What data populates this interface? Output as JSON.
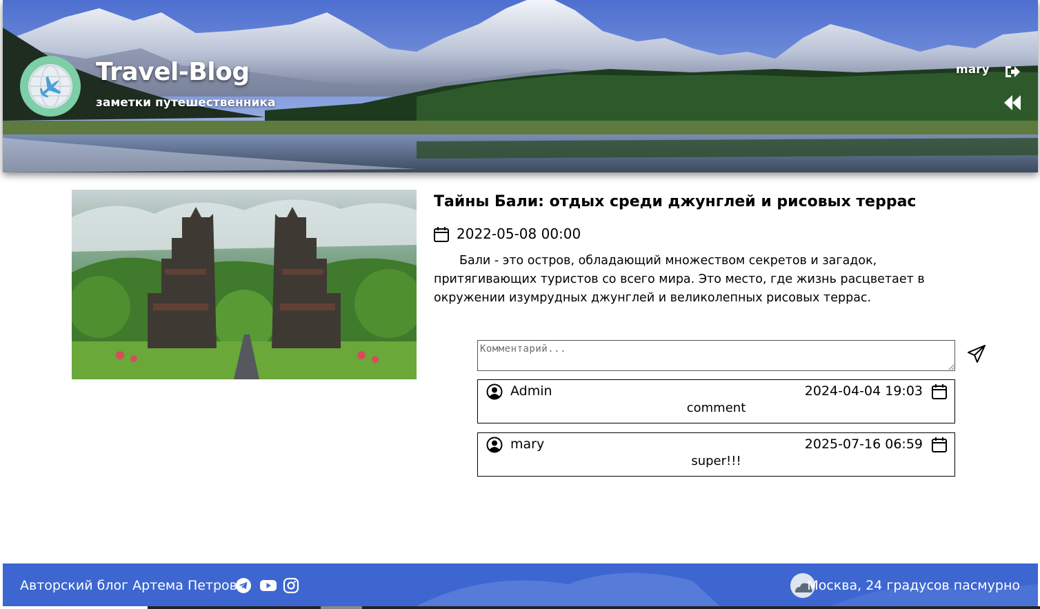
{
  "header": {
    "brand_title": "Travel-Blog",
    "brand_subtitle": "заметки путешественника",
    "user_name": "mary",
    "icons": {
      "logo": "globe-airplane-icon",
      "logout": "logout-icon",
      "back": "double-chevron-left-icon"
    }
  },
  "post": {
    "title": "Тайны Бали: отдых среди джунглей и рисовых террас",
    "date": "2022-05-08 00:00",
    "text": "Бали - это остров, обладающий множеством секретов и загадок, притягивающих туристов со всего мира. Это место, где жизнь расцветает в окружении изумрудных джунглей и великолепных рисовых террас."
  },
  "comments_section": {
    "input_placeholder": "Комментарий...",
    "input_value": "",
    "comments": [
      {
        "author": "Admin",
        "date": "2024-04-04 19:03",
        "text": "comment"
      },
      {
        "author": "mary",
        "date": "2025-07-16 06:59",
        "text": "super!!!"
      }
    ]
  },
  "footer": {
    "author_text": "Авторский блог Артема Петрова",
    "weather_text": "Москва, 24 градусов пасмурно",
    "social_icons": [
      "telegram-icon",
      "youtube-icon",
      "instagram-icon"
    ]
  },
  "colors": {
    "footer_bg": "#3d66d1",
    "logo_ring": "#7dcfa8",
    "plane": "#4a9fd8"
  }
}
